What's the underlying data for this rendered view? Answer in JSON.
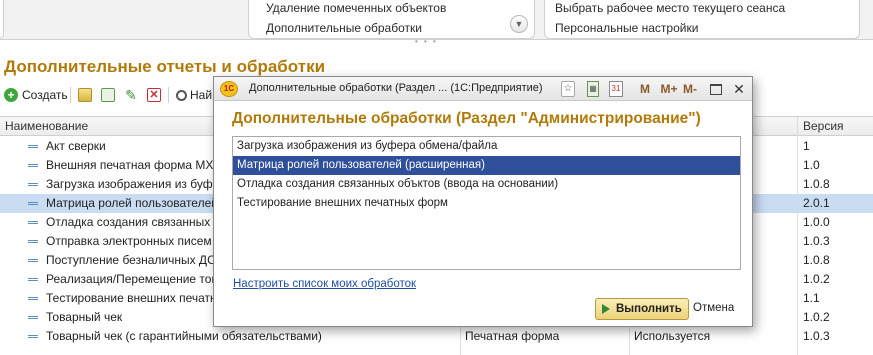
{
  "top_panel": {
    "middle_items": [
      "Удаление помеченных объектов",
      "Дополнительные обработки"
    ],
    "right_items": [
      "Выбрать рабочее место текущего сеанса",
      "Персональные настройки"
    ],
    "chevron": "chevron-down-icon"
  },
  "section_title": "Дополнительные отчеты и обработки",
  "toolbar": {
    "create_label": "Создать",
    "search_label": "Най"
  },
  "table": {
    "headers": {
      "name": "Наименование",
      "version": "Версия"
    },
    "rows": [
      {
        "name": "Акт сверки",
        "type": "",
        "usage": "",
        "version": "1",
        "selected": false
      },
      {
        "name": "Внешняя печатная форма МХ-1",
        "type": "",
        "usage": "",
        "version": "1.0",
        "selected": false
      },
      {
        "name": "Загрузка изображения из буфер",
        "type": "",
        "usage": "",
        "version": "1.0.8",
        "selected": false
      },
      {
        "name": "Матрица ролей пользователей (р",
        "type": "",
        "usage": "",
        "version": "2.0.1",
        "selected": true
      },
      {
        "name": "Отладка создания связанных об",
        "type": "",
        "usage": "",
        "version": "1.0.0",
        "selected": false
      },
      {
        "name": "Отправка электронных писем",
        "type": "",
        "usage": "",
        "version": "1.0.3",
        "selected": false
      },
      {
        "name": "Поступление  безналичных ДС/г",
        "type": "",
        "usage": "",
        "version": "1.0.8",
        "selected": false
      },
      {
        "name": "Реализация/Перемещение товар",
        "type": "",
        "usage": "",
        "version": "1.0.2",
        "selected": false
      },
      {
        "name": "Тестирование внешних печатных",
        "type": "",
        "usage": "",
        "version": "1.1",
        "selected": false
      },
      {
        "name": "Товарный чек",
        "type": "",
        "usage": "",
        "version": "1.0.2",
        "selected": false
      },
      {
        "name": "Товарный чек (с гарантийными обязательствами)",
        "type": "Печатная форма",
        "usage": "Используется",
        "version": "1.0.3",
        "selected": false
      }
    ]
  },
  "dialog": {
    "title": "Дополнительные обработки (Раздел ...  (1С:Предприятие)",
    "logo_text": "1С",
    "toolbar": {
      "m": "M",
      "m_plus": "M+",
      "m_minus": "M-",
      "minimize": "—",
      "close": "✕",
      "calendar": "31"
    },
    "heading": "Дополнительные обработки (Раздел \"Администрирование\")",
    "items": [
      {
        "label": "Загрузка изображения из буфера обмена/файла",
        "selected": false
      },
      {
        "label": "Матрица ролей пользователей (расширенная)",
        "selected": true
      },
      {
        "label": "Отладка создания связанных объктов (ввода на основании)",
        "selected": false
      },
      {
        "label": "Тестирование внешних печатных форм",
        "selected": false
      }
    ],
    "link": "Настроить список моих обработок",
    "run_button": "Выполнить",
    "cancel_button": "Отмена"
  }
}
